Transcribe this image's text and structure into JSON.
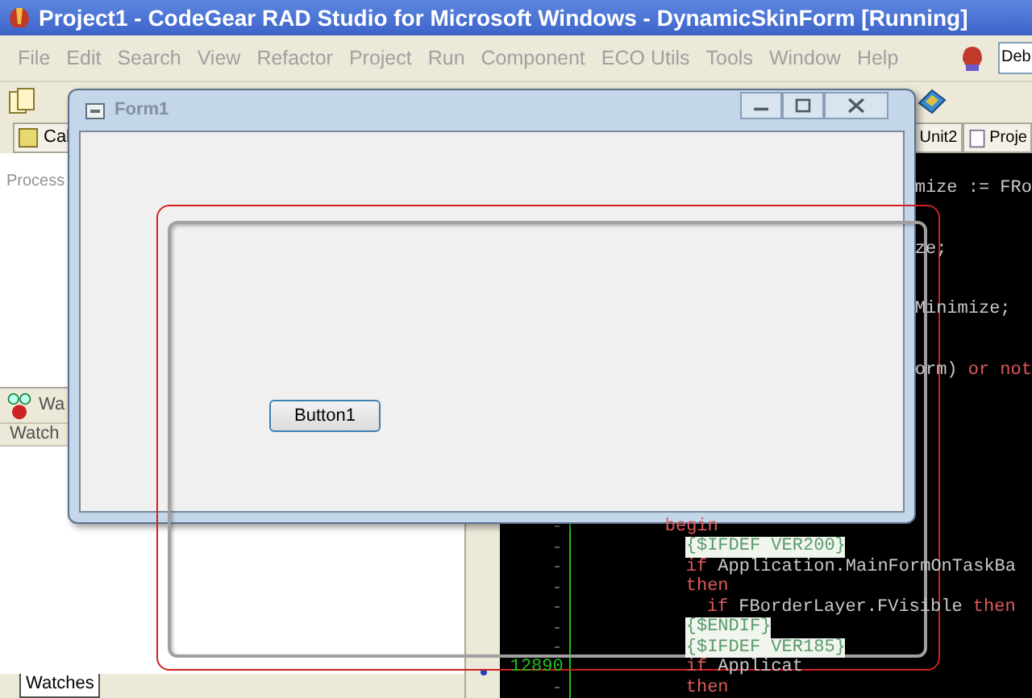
{
  "ide": {
    "title": "Project1 - CodeGear RAD Studio for Microsoft Windows - DynamicSkinForm [Running]",
    "menu": [
      "File",
      "Edit",
      "Search",
      "View",
      "Refactor",
      "Project",
      "Run",
      "Component",
      "ECO Utils",
      "Tools",
      "Window",
      "Help"
    ],
    "config_combo": {
      "value": "Deb"
    },
    "left_tabs": [
      {
        "label": "Cal"
      }
    ],
    "right_tabs": [
      {
        "label": "Unit2"
      },
      {
        "label": "Proje"
      }
    ],
    "process_panel": {
      "label": "Process"
    },
    "watch_panel": {
      "title": "Wa",
      "column_1": "Watch",
      "tab": "Watches"
    },
    "editor": {
      "upper_lines": [
        [
          {
            "text": "mize := FRo",
            "kind": "plain"
          }
        ],
        [
          {
            "text": "ze;",
            "kind": "plain"
          }
        ],
        [
          {
            "text": "Minimize;",
            "kind": "plain"
          }
        ],
        [
          {
            "text": "orm)",
            "kind": "plain"
          },
          {
            "text": " or not",
            "kind": "keyword"
          }
        ]
      ],
      "lines": [
        {
          "parts": [
            {
              "text": "begin",
              "kind": "keyword"
            }
          ],
          "children": [
            {
              "parts": [
                {
                  "text": "{$IFDEF VER200}",
                  "kind": "directive"
                }
              ]
            },
            {
              "parts": [
                {
                  "text": "if",
                  "kind": "keyword"
                },
                {
                  "text": " Application.MainFormOnTaskBa",
                  "kind": "plain"
                }
              ]
            },
            {
              "parts": [
                {
                  "text": "then",
                  "kind": "keyword"
                }
              ],
              "children": [
                {
                  "parts": [
                    {
                      "text": "if",
                      "kind": "keyword"
                    },
                    {
                      "text": " FBorderLayer.FVisible ",
                      "kind": "plain"
                    },
                    {
                      "text": "then",
                      "kind": "keyword"
                    }
                  ]
                }
              ]
            },
            {
              "parts": [
                {
                  "text": "{$ENDIF}",
                  "kind": "directive"
                }
              ]
            },
            {
              "parts": [
                {
                  "text": "{$IFDEF VER185}",
                  "kind": "directive"
                }
              ]
            },
            {
              "parts": [
                {
                  "text": "if",
                  "kind": "keyword"
                },
                {
                  "text": " Applicat",
                  "kind": "plain"
                }
              ],
              "number": "12890"
            },
            {
              "parts": [
                {
                  "text": "then",
                  "kind": "keyword"
                }
              ]
            }
          ]
        }
      ]
    }
  },
  "form": {
    "title": "Form1",
    "button": "Button1"
  }
}
